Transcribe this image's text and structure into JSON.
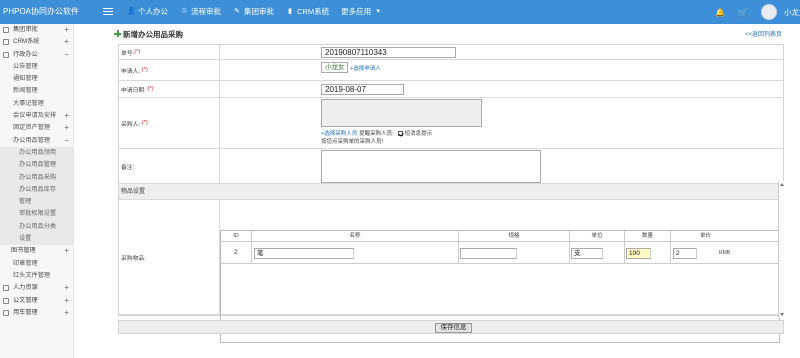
{
  "app": {
    "title": "PHPOA协同办公软件",
    "user_name": "小龙女"
  },
  "topnav": [
    {
      "label": "个人办公",
      "icon": "person-icon"
    },
    {
      "label": "流程审批",
      "icon": "flow-icon"
    },
    {
      "label": "集团审批",
      "icon": "edit-icon"
    },
    {
      "label": "CRM系统",
      "icon": "chart-icon"
    },
    {
      "label": "更多应用",
      "icon": "caret-down-icon"
    }
  ],
  "sidebar": [
    {
      "label": "集团审批",
      "toggle": "+"
    },
    {
      "label": "CRM系统",
      "toggle": "+"
    },
    {
      "label": "行政办公",
      "toggle": "−"
    },
    {
      "label": "公告管理"
    },
    {
      "label": "通知管理"
    },
    {
      "label": "新闻管理"
    },
    {
      "label": "大事记管理"
    },
    {
      "label": "会议申请及安排",
      "toggle": "+"
    },
    {
      "label": "固定资产管理",
      "toggle": "+"
    },
    {
      "label": "办公用品管理",
      "toggle": "−"
    },
    {
      "label": "办公用品领用"
    },
    {
      "label": "办公用品管理"
    },
    {
      "label": "办公用品采购"
    },
    {
      "label": "办公用品库存"
    },
    {
      "label": "管理"
    },
    {
      "label": "审批权限设置"
    },
    {
      "label": "办公用品分类"
    },
    {
      "label": "设置"
    },
    {
      "label": "图书管理",
      "toggle": "+"
    },
    {
      "label": "印章管理"
    },
    {
      "label": "红头文件管理"
    },
    {
      "label": "人力资源",
      "toggle": "+"
    },
    {
      "label": "公文管理",
      "toggle": "+"
    },
    {
      "label": "用车管理",
      "toggle": "+"
    }
  ],
  "page": {
    "title": "新增办公用品采购",
    "back_link": "<<返回列表页"
  },
  "form": {
    "number_label": "单号:",
    "number_value": "20190807110343",
    "applicant_label": "申请人:",
    "applicant_value": "小龙女",
    "applicant_link": "+选择申请人",
    "date_label": "申请日期:",
    "date_value": "2019-08-07",
    "buyer_label": "采购人:",
    "buyer_link": "+选择采购人员",
    "remind_text": "提醒采购人员:",
    "sms_text": "短消息提示",
    "hint_text": "按您点采购单的采购人员!",
    "note_label": "备注:",
    "section_label": "物品设置",
    "goods_label": "采购物品:",
    "required_mark": "(*)",
    "save_label": "保存信息"
  },
  "items": {
    "headers": [
      "ID",
      "名称",
      "规格",
      "单位",
      "数量",
      "单价"
    ],
    "rows": [
      {
        "id": "2",
        "name": "笔",
        "spec": "",
        "unit": "支",
        "qty": "100",
        "price": "2",
        "currency": "RMB"
      }
    ]
  }
}
